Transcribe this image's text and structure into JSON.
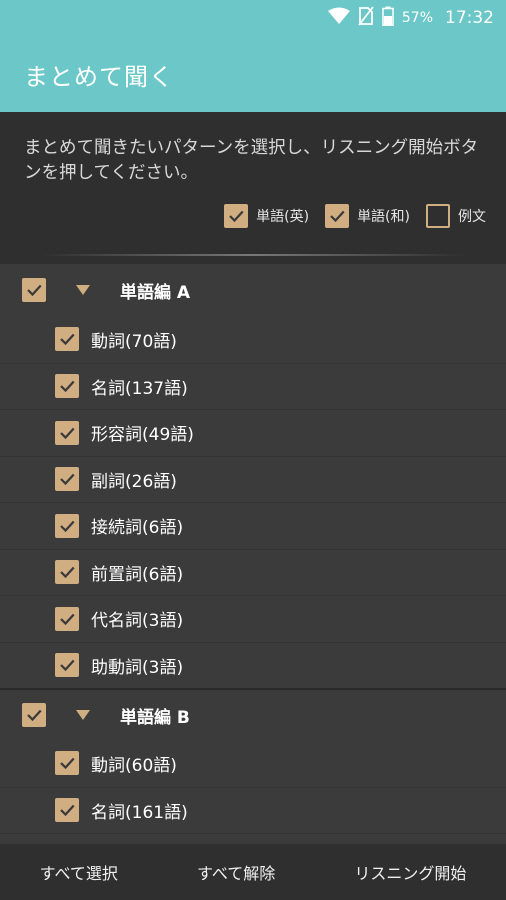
{
  "statusbar": {
    "battery": "57%",
    "time": "17:32",
    "icons": [
      "wifi-icon",
      "no-sim-icon",
      "battery-icon"
    ]
  },
  "appbar": {
    "title": "まとめて聞く"
  },
  "instructions": {
    "text": "まとめて聞きたいパターンを選択し、リスニング開始ボタンを押してください。"
  },
  "options": [
    {
      "label": "単語(英)",
      "checked": true
    },
    {
      "label": "単語(和)",
      "checked": true
    },
    {
      "label": "例文",
      "checked": false
    }
  ],
  "groups": [
    {
      "label": "単語編 A",
      "checked": true,
      "items": [
        {
          "label": "動詞(70語)",
          "checked": true
        },
        {
          "label": "名詞(137語)",
          "checked": true
        },
        {
          "label": "形容詞(49語)",
          "checked": true
        },
        {
          "label": "副詞(26語)",
          "checked": true
        },
        {
          "label": "接続詞(6語)",
          "checked": true
        },
        {
          "label": "前置詞(6語)",
          "checked": true
        },
        {
          "label": "代名詞(3語)",
          "checked": true
        },
        {
          "label": "助動詞(3語)",
          "checked": true
        }
      ]
    },
    {
      "label": "単語編 B",
      "checked": true,
      "items": [
        {
          "label": "動詞(60語)",
          "checked": true
        },
        {
          "label": "名詞(161語)",
          "checked": true
        }
      ]
    }
  ],
  "bottom": {
    "select_all": "すべて選択",
    "deselect_all": "すべて解除",
    "start": "リスニング開始"
  },
  "colors": {
    "accent": "#6cc8c8",
    "checkbox": "#d1ad82",
    "background": "#3a3a3a"
  }
}
